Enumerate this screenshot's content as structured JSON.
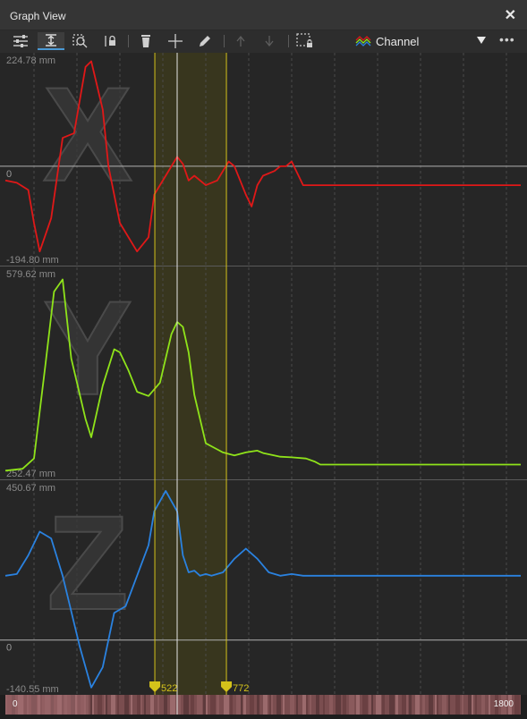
{
  "window": {
    "title": "Graph View",
    "close_label": "✕"
  },
  "toolbar": {
    "buttons": [
      {
        "name": "curve-settings-icon"
      },
      {
        "name": "fit-view-icon",
        "active": true
      },
      {
        "name": "zoom-icon"
      },
      {
        "name": "lock-icon"
      },
      {
        "name": "delete-icon"
      },
      {
        "name": "move-icon"
      },
      {
        "name": "pen-icon"
      },
      {
        "name": "key-up-icon",
        "disabled": true
      },
      {
        "name": "key-down-icon",
        "disabled": true
      },
      {
        "name": "selection-lock-icon"
      }
    ],
    "channel_label": "Channel",
    "more_label": "•••"
  },
  "colors": {
    "x": "#e01818",
    "y": "#8fe31a",
    "z": "#2a82e0",
    "marker": "#d4c21a",
    "playhead": "#e6e6e6"
  },
  "chart_data": [
    {
      "type": "line",
      "watermark": "X",
      "max_label": "224.78 mm",
      "min_label": "-194.80 mm",
      "zero_label": "0",
      "ylim": [
        -194.8,
        224.78
      ],
      "series": [
        {
          "color": "#e01818",
          "x": [
            0,
            40,
            80,
            100,
            120,
            160,
            200,
            240,
            260,
            280,
            300,
            340,
            360,
            400,
            460,
            500,
            520,
            560,
            600,
            620,
            640,
            660,
            700,
            740,
            760,
            780,
            800,
            840,
            860,
            880,
            900,
            940,
            960,
            980,
            1000,
            1040,
            1080,
            1100,
            1200,
            1400,
            1600,
            1800
          ],
          "values": [
            -30,
            -35,
            -50,
            -120,
            -180,
            -110,
            60,
            70,
            140,
            210,
            222,
            120,
            0,
            -120,
            -180,
            -150,
            -60,
            -20,
            20,
            5,
            -30,
            -20,
            -40,
            -30,
            -10,
            10,
            0,
            -60,
            -85,
            -40,
            -20,
            -10,
            0,
            0,
            10,
            -40,
            -40,
            -40,
            -40,
            -40,
            -40,
            -40
          ]
        }
      ]
    },
    {
      "type": "line",
      "watermark": "Y",
      "max_label": "579.62 mm",
      "min_label": "252.47 mm",
      "ylim": [
        252.47,
        579.62
      ],
      "series": [
        {
          "color": "#8fe31a",
          "x": [
            0,
            60,
            100,
            140,
            170,
            200,
            230,
            280,
            300,
            340,
            380,
            400,
            430,
            460,
            500,
            540,
            560,
            580,
            600,
            620,
            640,
            660,
            700,
            740,
            760,
            800,
            840,
            880,
            900,
            960,
            1000,
            1050,
            1080,
            1100,
            1200,
            1300,
            1400,
            1600,
            1800
          ],
          "values": [
            255,
            258,
            275,
            430,
            550,
            570,
            440,
            340,
            310,
            395,
            455,
            450,
            420,
            385,
            378,
            400,
            440,
            480,
            500,
            492,
            450,
            380,
            300,
            290,
            285,
            280,
            285,
            288,
            284,
            278,
            277,
            275,
            270,
            265,
            265,
            265,
            265,
            265,
            265
          ]
        }
      ]
    },
    {
      "type": "line",
      "watermark": "Z",
      "max_label": "450.67 mm",
      "min_label": "-140.55 mm",
      "zero_label": "0",
      "ylim": [
        -140.55,
        450.67
      ],
      "series": [
        {
          "color": "#2a82e0",
          "x": [
            0,
            40,
            80,
            120,
            160,
            200,
            260,
            300,
            340,
            380,
            420,
            460,
            500,
            520,
            560,
            600,
            620,
            640,
            660,
            680,
            700,
            720,
            760,
            800,
            840,
            880,
            920,
            960,
            1000,
            1040,
            1080,
            1120,
            1200,
            1400,
            1600,
            1800
          ],
          "values": [
            190,
            195,
            250,
            320,
            300,
            190,
            -20,
            -140,
            -80,
            80,
            100,
            190,
            280,
            380,
            440,
            380,
            250,
            200,
            205,
            190,
            195,
            190,
            200,
            240,
            270,
            240,
            200,
            190,
            195,
            190,
            190,
            190,
            190,
            190,
            190,
            190
          ]
        }
      ]
    }
  ],
  "timeline": {
    "start": 0,
    "end": 1800,
    "playhead": 600,
    "marker_start": 522,
    "marker_end": 772,
    "start_label": "0",
    "end_label": "1800",
    "marker_start_label": "522",
    "marker_end_label": "772"
  }
}
